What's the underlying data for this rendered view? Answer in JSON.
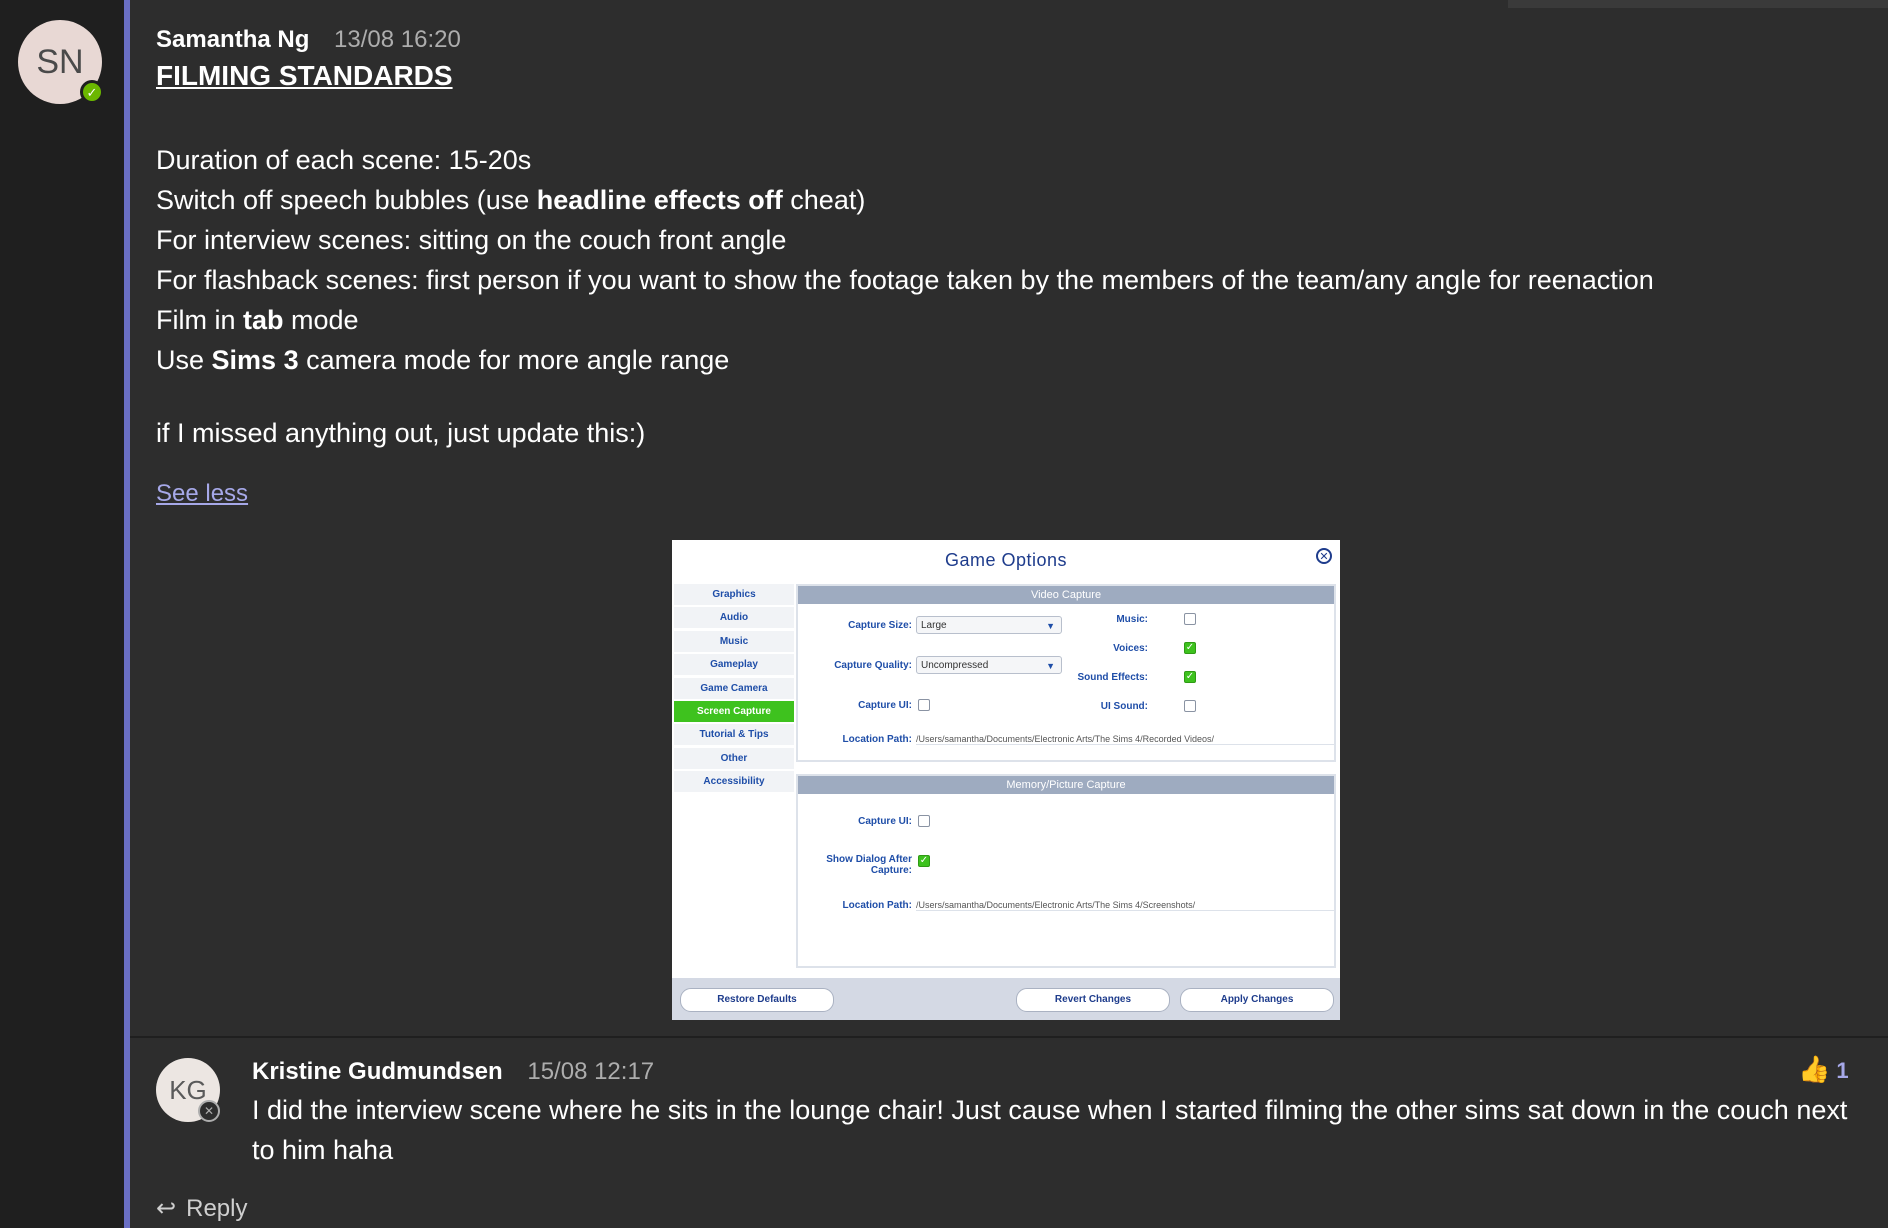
{
  "post": {
    "author_initials": "SN",
    "author": "Samantha Ng",
    "timestamp": "13/08 16:20",
    "title": "FILMING STANDARDS",
    "lines": [
      {
        "pre": "Duration of each scene: 15-20s",
        "bold": "",
        "post": ""
      },
      {
        "pre": "Switch off speech bubbles (use ",
        "bold": "headline effects off",
        "post": " cheat)"
      },
      {
        "pre": "For interview scenes: sitting on the couch front angle",
        "bold": "",
        "post": ""
      },
      {
        "pre": "For flashback scenes: first person if you want to show the footage taken by the members of the team/any angle for reenaction",
        "bold": "",
        "post": ""
      },
      {
        "pre": "Film in ",
        "bold": "tab",
        "post": " mode"
      },
      {
        "pre": "Use ",
        "bold": "Sims 3",
        "post": " camera mode for more angle range"
      }
    ],
    "footnote": "if I missed anything out, just update this:)",
    "see_less": "See less"
  },
  "embed": {
    "title": "Game Options",
    "nav": [
      "Graphics",
      "Audio",
      "Music",
      "Gameplay",
      "Game Camera",
      "Screen Capture",
      "Tutorial & Tips",
      "Other",
      "Accessibility"
    ],
    "active_nav": "Screen Capture",
    "video_capture": {
      "heading": "Video Capture",
      "capture_size_label": "Capture Size:",
      "capture_size_value": "Large",
      "capture_quality_label": "Capture Quality:",
      "capture_quality_value": "Uncompressed",
      "capture_ui_label": "Capture UI:",
      "music_label": "Music:",
      "voices_label": "Voices:",
      "sound_effects_label": "Sound Effects:",
      "ui_sound_label": "UI Sound:",
      "location_label": "Location Path:",
      "location_value": "/Users/samantha/Documents/Electronic Arts/The Sims 4/Recorded Videos/"
    },
    "memory_capture": {
      "heading": "Memory/Picture Capture",
      "capture_ui_label": "Capture UI:",
      "show_dialog_label": "Show Dialog After Capture:",
      "location_label": "Location Path:",
      "location_value": "/Users/samantha/Documents/Electronic Arts/The Sims 4/Screenshots/"
    },
    "buttons": {
      "restore": "Restore Defaults",
      "revert": "Revert Changes",
      "apply": "Apply Changes"
    }
  },
  "reply": {
    "author_initials": "KG",
    "author": "Kristine Gudmundsen",
    "timestamp": "15/08 12:17",
    "body": "I did the interview scene where he sits in the lounge chair! Just cause when I started filming the other sims sat down in the couch next to him haha",
    "reaction_icon": "thumbs-up",
    "reaction_count": "1"
  },
  "reply_action": "Reply",
  "colors": {
    "thread_accent": "#6a6fc4",
    "link": "#a6a8e8",
    "presence_available": "#6bb700",
    "game_active_tab": "#3ec21e"
  }
}
